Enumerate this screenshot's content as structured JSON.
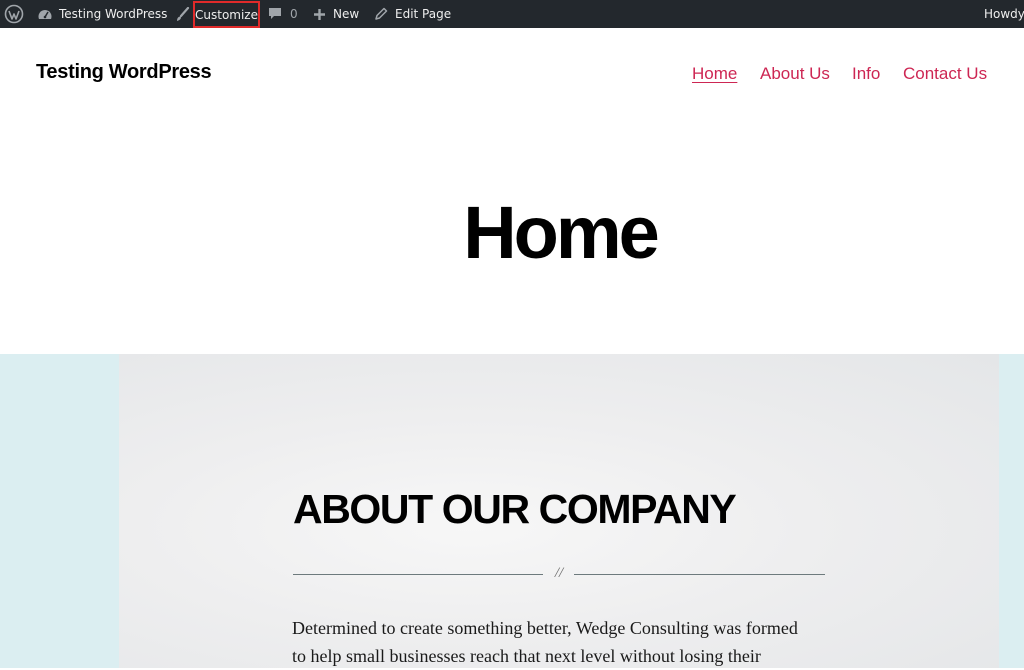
{
  "admin_bar": {
    "site_name": "Testing WordPress",
    "customize_label": "Customize",
    "comments_count": "0",
    "new_label": "New",
    "edit_label": "Edit Page",
    "howdy_label": "Howdy,",
    "colors": {
      "background": "#23282d",
      "highlight_border": "#e02a2a"
    }
  },
  "header": {
    "site_title": "Testing WordPress",
    "nav": [
      {
        "label": "Home",
        "current": true
      },
      {
        "label": "About Us"
      },
      {
        "label": "Info"
      },
      {
        "label": "Contact Us"
      }
    ],
    "accent_color": "#cd2653"
  },
  "page": {
    "title": "Home"
  },
  "cover": {
    "heading": "ABOUT OUR COMPANY",
    "separator_mark": "//",
    "paragraph_lines": [
      "Determined to create something better, Wedge Consulting was formed",
      "to help small businesses reach that next level without losing their"
    ],
    "colors": {
      "outer_background": "#dbeef1"
    }
  }
}
